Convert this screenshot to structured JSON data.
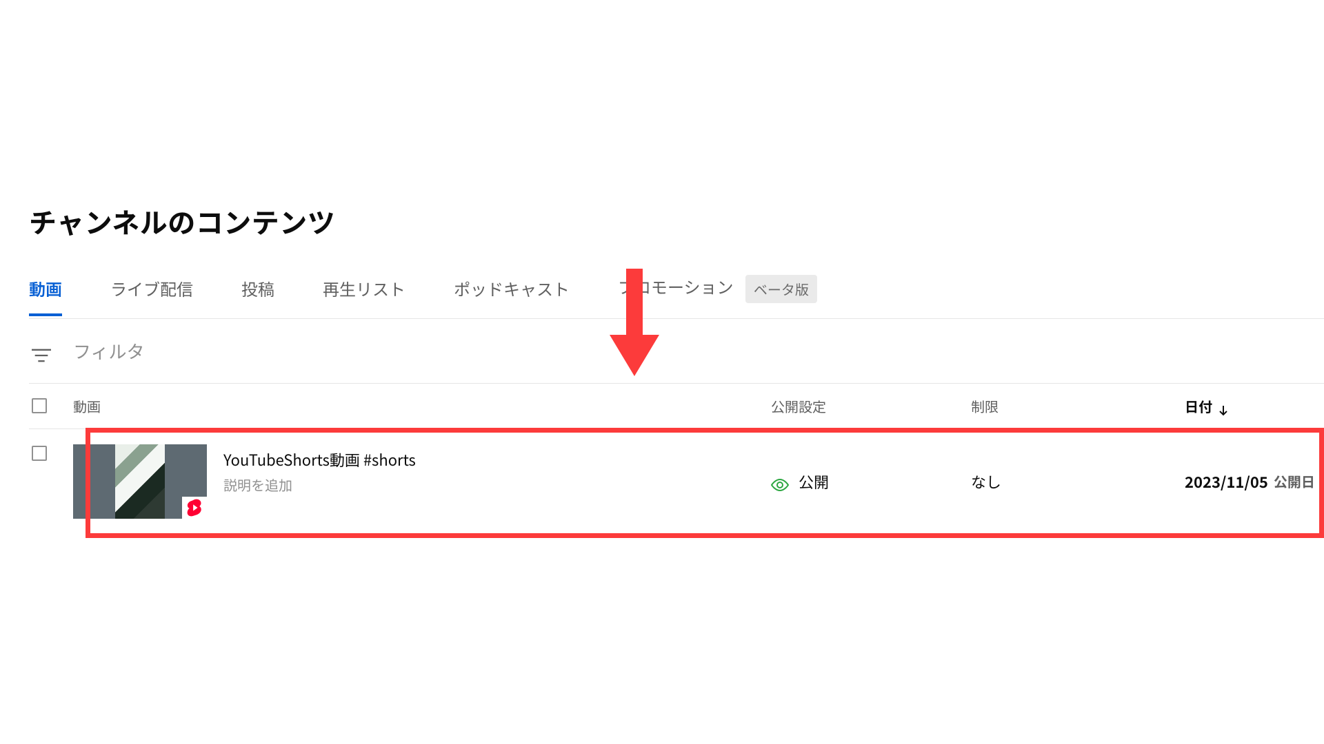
{
  "page_title": "チャンネルのコンテンツ",
  "tabs": [
    {
      "label": "動画",
      "active": true
    },
    {
      "label": "ライブ配信",
      "active": false
    },
    {
      "label": "投稿",
      "active": false
    },
    {
      "label": "再生リスト",
      "active": false
    },
    {
      "label": "ポッドキャスト",
      "active": false
    },
    {
      "label": "プロモーション",
      "active": false,
      "badge": "ベータ版"
    }
  ],
  "filter_placeholder": "フィルタ",
  "columns": {
    "video": "動画",
    "visibility": "公開設定",
    "restriction": "制限",
    "date": "日付"
  },
  "rows": [
    {
      "title": "YouTubeShorts動画 #shorts",
      "description": "説明を追加",
      "visibility": "公開",
      "restriction": "なし",
      "date": "2023/11/05",
      "date_sub": "公開日"
    }
  ],
  "annotation": {
    "arrow_color": "#fc3b3b",
    "box_color": "#fc3b3b"
  }
}
